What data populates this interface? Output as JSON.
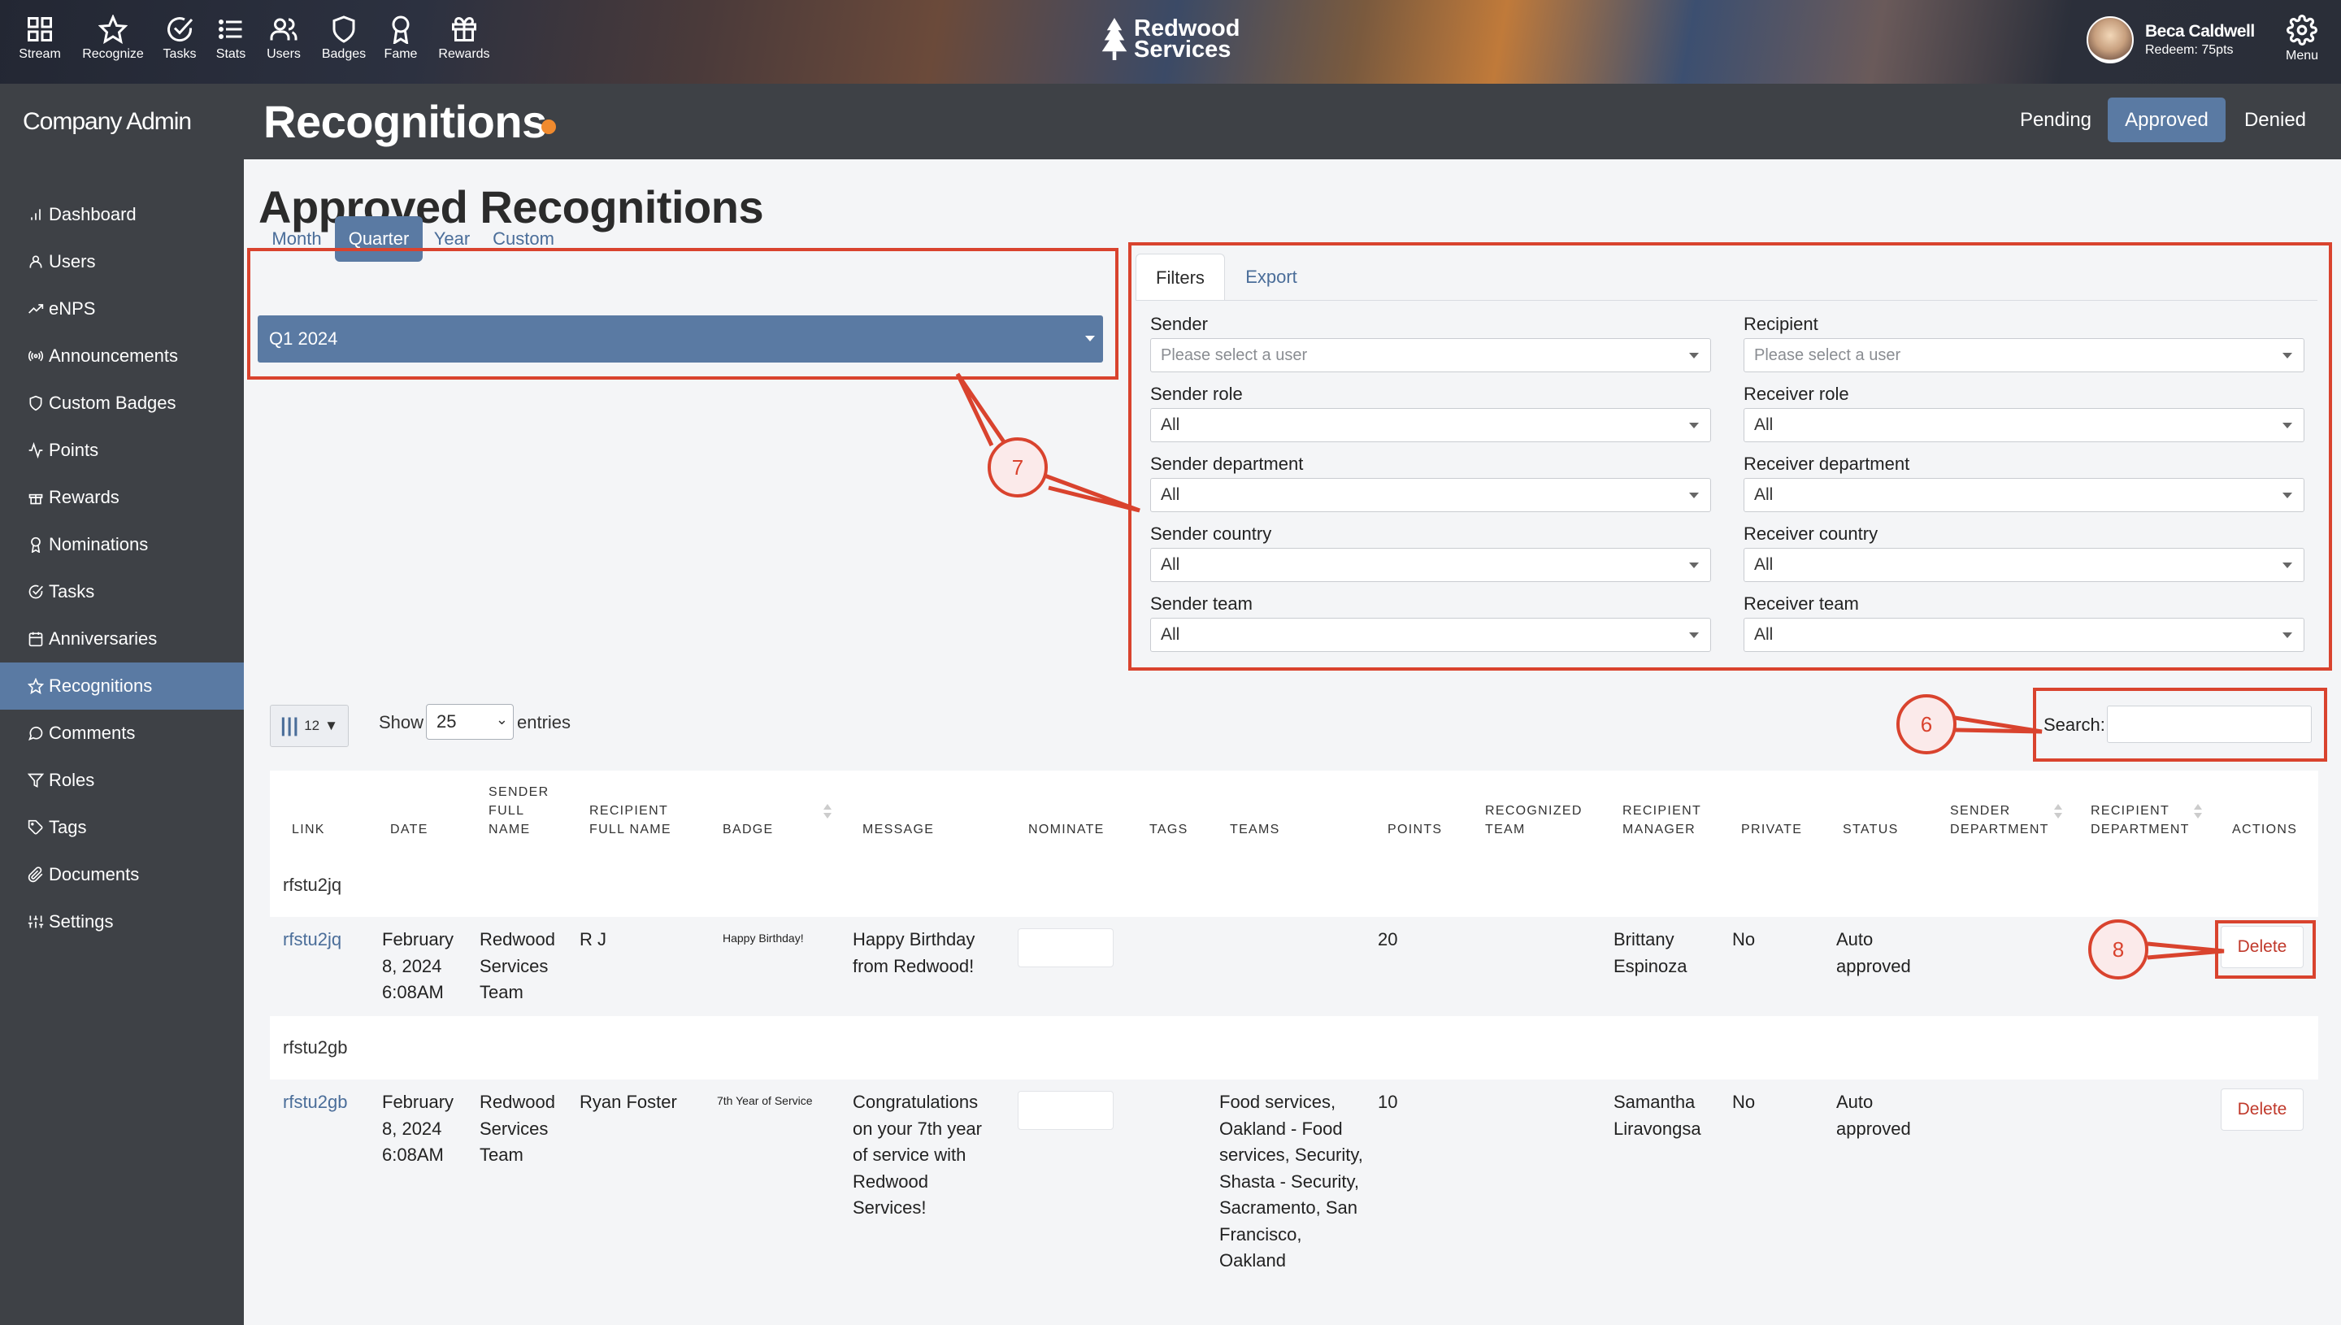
{
  "topnav": {
    "items": [
      {
        "label": "Stream",
        "icon": "grid-icon"
      },
      {
        "label": "Recognize",
        "icon": "star-icon"
      },
      {
        "label": "Tasks",
        "icon": "check-circle-icon"
      },
      {
        "label": "Stats",
        "icon": "list-icon"
      },
      {
        "label": "Users",
        "icon": "users-icon"
      },
      {
        "label": "Badges",
        "icon": "shield-icon"
      },
      {
        "label": "Fame",
        "icon": "award-icon"
      },
      {
        "label": "Rewards",
        "icon": "gift-icon"
      }
    ],
    "brand": "Redwood Services",
    "user_name": "Beca Caldwell",
    "user_points": "Redeem: 75pts",
    "menu_label": "Menu"
  },
  "sidebar": {
    "title": "Company Admin",
    "items": [
      {
        "label": "Dashboard",
        "icon": "bar-chart-icon"
      },
      {
        "label": "Users",
        "icon": "user-icon"
      },
      {
        "label": "eNPS",
        "icon": "trend-icon"
      },
      {
        "label": "Announcements",
        "icon": "broadcast-icon"
      },
      {
        "label": "Custom Badges",
        "icon": "shield-icon"
      },
      {
        "label": "Points",
        "icon": "activity-icon"
      },
      {
        "label": "Rewards",
        "icon": "gift-icon"
      },
      {
        "label": "Nominations",
        "icon": "award-icon"
      },
      {
        "label": "Tasks",
        "icon": "check-circle-icon"
      },
      {
        "label": "Anniversaries",
        "icon": "calendar-icon"
      },
      {
        "label": "Recognitions",
        "icon": "star-icon",
        "active": true
      },
      {
        "label": "Comments",
        "icon": "comment-icon"
      },
      {
        "label": "Roles",
        "icon": "filter-icon"
      },
      {
        "label": "Tags",
        "icon": "tag-icon"
      },
      {
        "label": "Documents",
        "icon": "paperclip-icon"
      },
      {
        "label": "Settings",
        "icon": "sliders-icon"
      }
    ]
  },
  "header": {
    "title": "Recognitions",
    "status_tabs": [
      "Pending",
      "Approved",
      "Denied"
    ],
    "active_status": "Approved"
  },
  "main": {
    "title": "Approved Recognitions",
    "range_tabs": [
      "Month",
      "Quarter",
      "Year",
      "Custom"
    ],
    "active_range": "Quarter",
    "period_value": "Q1 2024",
    "panel_tabs": [
      "Filters",
      "Export"
    ],
    "filters": {
      "sender_label": "Sender",
      "sender_placeholder": "Please select a user",
      "recipient_label": "Recipient",
      "recipient_placeholder": "Please select a user",
      "sender_role_label": "Sender role",
      "sender_role_value": "All",
      "receiver_role_label": "Receiver role",
      "receiver_role_value": "All",
      "sender_department_label": "Sender department",
      "sender_department_value": "All",
      "receiver_department_label": "Receiver department",
      "receiver_department_value": "All",
      "sender_country_label": "Sender country",
      "sender_country_value": "All",
      "receiver_country_label": "Receiver country",
      "receiver_country_value": "All",
      "sender_team_label": "Sender team",
      "sender_team_value": "All",
      "receiver_team_label": "Receiver team",
      "receiver_team_value": "All"
    },
    "table_controls": {
      "columns_count": "12",
      "show_label": "Show",
      "show_value": "25",
      "entries_label": "entries",
      "search_label": "Search:"
    },
    "columns": [
      "Link",
      "Date",
      "Sender Full Name",
      "Recipient Full Name",
      "Badge",
      "Message",
      "Nominate",
      "Tags",
      "Teams",
      "Points",
      "Recognized Team",
      "Recipient Manager",
      "Private",
      "Status",
      "Sender Department",
      "Recipient Department",
      "Actions"
    ],
    "rows": [
      {
        "group": "rfstu2jq",
        "link": "rfstu2jq",
        "date": "February 8, 2024 6:08AM",
        "sender": "Redwood Services Team",
        "recipient": "R J",
        "badge": "Happy Birthday!",
        "message": "Happy Birthday from Redwood!",
        "teams": "",
        "points": "20",
        "manager": "Brittany Espinoza",
        "private": "No",
        "status": "Auto approved",
        "action": "Delete"
      },
      {
        "group": "rfstu2gb",
        "link": "rfstu2gb",
        "date": "February 8, 2024 6:08AM",
        "sender": "Redwood Services Team",
        "recipient": "Ryan Foster",
        "badge": "7th Year of Service",
        "message": "Congratulations on your 7th year of service with Redwood Services!",
        "teams": "Food services, Oakland - Food services, Security, Shasta - Security, Sacramento, San Francisco, Oakland",
        "points": "10",
        "manager": "Samantha Liravongsa",
        "private": "No",
        "status": "Auto approved",
        "action": "Delete"
      }
    ]
  },
  "annotations": [
    "7",
    "6",
    "8"
  ],
  "colors": {
    "accent": "#5a7aa3",
    "sidebar": "#3e4146",
    "annotation": "#d9432e",
    "dot": "#f08a2e",
    "delete": "#c0392b"
  }
}
